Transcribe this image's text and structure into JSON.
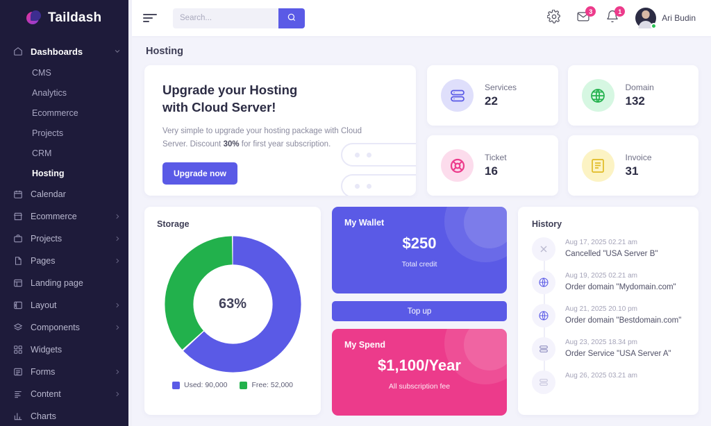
{
  "brand": {
    "name": "Taildash",
    "logo_icon": "taildash-logo-icon"
  },
  "sidebar": {
    "items": [
      {
        "label": "Dashboards",
        "icon": "home-icon",
        "expanded": true,
        "chevron": "chevron-down-icon",
        "children": [
          {
            "label": "CMS",
            "active": false
          },
          {
            "label": "Analytics",
            "active": false
          },
          {
            "label": "Ecommerce",
            "active": false
          },
          {
            "label": "Projects",
            "active": false
          },
          {
            "label": "CRM",
            "active": false
          },
          {
            "label": "Hosting",
            "active": true
          }
        ]
      },
      {
        "label": "Calendar",
        "icon": "calendar-icon",
        "chevron": null
      },
      {
        "label": "Ecommerce",
        "icon": "store-icon",
        "chevron": "chevron-right-icon"
      },
      {
        "label": "Projects",
        "icon": "briefcase-icon",
        "chevron": "chevron-right-icon"
      },
      {
        "label": "Pages",
        "icon": "page-icon",
        "chevron": "chevron-right-icon"
      },
      {
        "label": "Landing page",
        "icon": "layout-template-icon",
        "chevron": null
      },
      {
        "label": "Layout",
        "icon": "sidebar-layout-icon",
        "chevron": "chevron-right-icon"
      },
      {
        "label": "Components",
        "icon": "layers-icon",
        "chevron": "chevron-right-icon"
      },
      {
        "label": "Widgets",
        "icon": "widgets-grid-icon",
        "chevron": null
      },
      {
        "label": "Forms",
        "icon": "form-icon",
        "chevron": "chevron-right-icon"
      },
      {
        "label": "Content",
        "icon": "content-lines-icon",
        "chevron": "chevron-right-icon"
      },
      {
        "label": "Charts",
        "icon": "bar-chart-icon",
        "chevron": null
      }
    ]
  },
  "topbar": {
    "menu_icon": "hamburger-icon",
    "search": {
      "placeholder": "Search...",
      "value": "",
      "button_icon": "search-icon"
    },
    "settings_icon": "gear-icon",
    "mail": {
      "icon": "mail-icon",
      "badge": "3"
    },
    "notifications": {
      "icon": "bell-icon",
      "badge": "1"
    },
    "profile": {
      "name": "Ari Budin",
      "avatar_icon": "avatar",
      "status": "online"
    }
  },
  "page": {
    "title": "Hosting"
  },
  "banner": {
    "heading_line1": "Upgrade your Hosting",
    "heading_line2": "with Cloud Server!",
    "description_part1": "Very simple to upgrade your hosting package with Cloud Server. Discount ",
    "description_highlight": "30%",
    "description_part2": " for first year subscription.",
    "cta_label": "Upgrade now",
    "decor_icon": "server-rack-icon"
  },
  "stats": [
    {
      "label": "Services",
      "value": "22",
      "icon": "server-icon",
      "color": "#5a5ae6",
      "bg": "#dfdffb"
    },
    {
      "label": "Domain",
      "value": "132",
      "icon": "globe-icon",
      "color": "#22b14c",
      "bg": "#d6f7e2"
    },
    {
      "label": "Ticket",
      "value": "16",
      "icon": "lifebuoy-icon",
      "color": "#ec3b8b",
      "bg": "#fcdcec"
    },
    {
      "label": "Invoice",
      "value": "31",
      "icon": "invoice-icon",
      "color": "#e0bb25",
      "bg": "#fcf3c4"
    }
  ],
  "storage": {
    "title": "Storage",
    "center_label": "63%"
  },
  "chart_data": {
    "type": "pie",
    "title": "Storage",
    "labels": [
      "Used",
      "Free"
    ],
    "values": [
      90000,
      52000
    ],
    "legend": [
      "Used: 90,000",
      "Free: 52,000"
    ],
    "colors": [
      "#5a5ae6",
      "#22b14c"
    ],
    "center_label": "63%",
    "legend_position": "bottom",
    "donut": true,
    "percentages": [
      63,
      37
    ]
  },
  "wallet": {
    "title": "My Wallet",
    "amount": "$250",
    "subtitle": "Total credit",
    "topup_label": "Top up"
  },
  "spend": {
    "title": "My Spend",
    "amount": "$1,100/Year",
    "subtitle": "All subscription fee"
  },
  "history": {
    "title": "History",
    "items": [
      {
        "time": "Aug 17, 2025 02.21 am",
        "text": "Cancelled \"USA Server B\"",
        "icon": "close-icon",
        "color": "#b9b8cf"
      },
      {
        "time": "Aug 19, 2025 02.21 am",
        "text": "Order domain \"Mydomain.com\"",
        "icon": "globe-icon",
        "color": "#5a5ae6"
      },
      {
        "time": "Aug 21, 2025 20.10 pm",
        "text": "Order domain \"Bestdomain.com\"",
        "icon": "globe-icon",
        "color": "#5a5ae6"
      },
      {
        "time": "Aug 23, 2025 18.34 pm",
        "text": "Order Service \"USA Server A\"",
        "icon": "server-icon",
        "color": "#8f8ec0"
      },
      {
        "time": "Aug 26, 2025 03.21 am",
        "text": "",
        "icon": "server-icon",
        "color": "#c9c8de"
      }
    ]
  }
}
